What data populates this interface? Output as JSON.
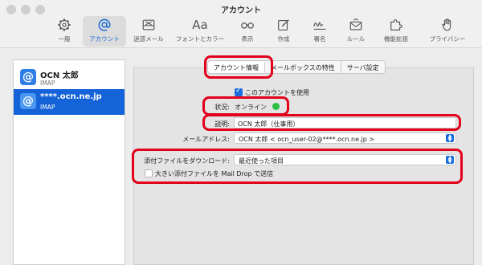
{
  "window": {
    "title": "アカウント"
  },
  "toolbar": {
    "items": [
      {
        "label": "一般",
        "icon": "gear-icon"
      },
      {
        "label": "アカウント",
        "icon": "at-sign-icon",
        "active": true
      },
      {
        "label": "迷惑メール",
        "icon": "junk-tray-icon"
      },
      {
        "label": "フォントとカラー",
        "icon": "font-aa-icon",
        "glyph": "Aa"
      },
      {
        "label": "表示",
        "icon": "glasses-icon"
      },
      {
        "label": "作成",
        "icon": "compose-icon"
      },
      {
        "label": "署名",
        "icon": "signature-icon"
      },
      {
        "label": "ルール",
        "icon": "rules-envelope-icon"
      },
      {
        "label": "機能拡張",
        "icon": "puzzle-icon"
      },
      {
        "label": "プライバシー",
        "icon": "hand-icon"
      }
    ]
  },
  "sidebar": {
    "accounts": [
      {
        "name": "OCN 太郎",
        "type": "IMAP",
        "icon_glyph": "@"
      },
      {
        "name": "****.ocn.ne.jp",
        "type": "IMAP",
        "icon_glyph": "@",
        "selected": true
      }
    ]
  },
  "tabs": [
    {
      "label": "アカウント情報",
      "active": true
    },
    {
      "label": "メールボックスの特性"
    },
    {
      "label": "サーバ設定"
    }
  ],
  "account_info": {
    "enable_label": "このアカウントを使用",
    "enable_checked": true,
    "status_label": "状況:",
    "status_value": "オンライン",
    "description_label": "説明:",
    "description_value": "OCN 太郎（仕事用）",
    "email_label": "メールアドレス:",
    "email_value": "OCN 太郎 < ocn_user-02@****.ocn.ne.jp >",
    "download_label": "添付ファイルをダウンロード:",
    "download_value": "最近使った項目",
    "maildrop_label": "大きい添付ファイルを Mail Drop で送信",
    "maildrop_checked": false
  },
  "colors": {
    "accent": "#1a6fe0",
    "selection": "#1463d8",
    "status_online": "#2fc043",
    "highlight": "#e3001b"
  }
}
